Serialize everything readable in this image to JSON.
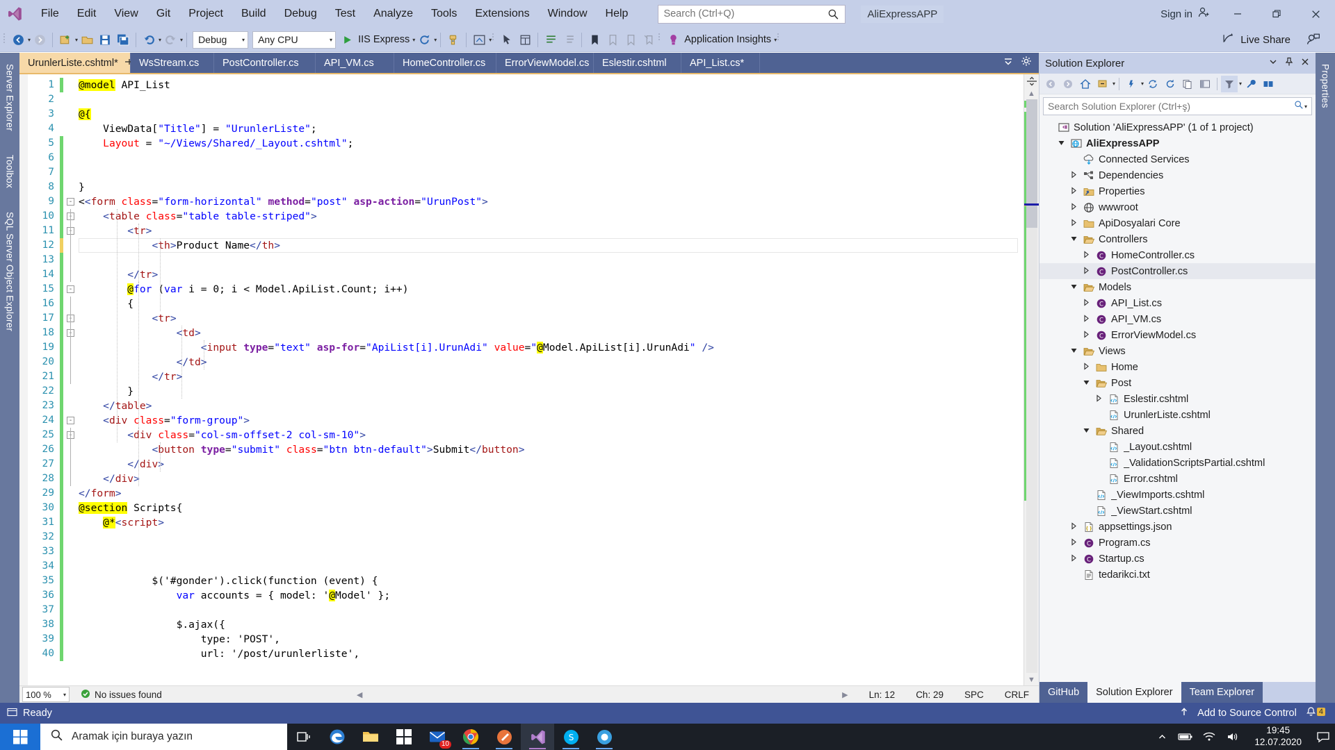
{
  "titlebar": {
    "logo_icon": "visual-studio-logo",
    "menus": [
      "File",
      "Edit",
      "View",
      "Git",
      "Project",
      "Build",
      "Debug",
      "Test",
      "Analyze",
      "Tools",
      "Extensions",
      "Window",
      "Help"
    ],
    "search_placeholder": "Search (Ctrl+Q)",
    "search_icon": "magnifier-icon",
    "project_name": "AliExpressAPP",
    "sign_in": "Sign in",
    "sign_in_icon": "account-add-icon",
    "minimize_icon": "minimize-icon",
    "restore_icon": "restore-icon",
    "close_icon": "close-icon"
  },
  "toolbar": {
    "back_icon": "navigate-back-icon",
    "forward_icon": "navigate-forward-icon",
    "new_project_icon": "new-project-icon",
    "open_icon": "open-file-icon",
    "save_icon": "save-icon",
    "save_all_icon": "save-all-icon",
    "undo_icon": "undo-icon",
    "redo_icon": "redo-icon",
    "config_value": "Debug",
    "platform_value": "Any CPU",
    "run_icon": "play-icon",
    "run_label": "IIS Express",
    "hot_reload_icon": "hot-reload-icon",
    "bookmark_icon": "bookmark-icon",
    "app_insights_label": "Application Insights",
    "live_share_label": "Live Share",
    "live_share_icon": "live-share-icon",
    "feedback_icon": "feedback-icon"
  },
  "left_dock": [
    "Server Explorer",
    "Toolbox",
    "SQL Server Object Explorer"
  ],
  "right_dock": [
    "Properties"
  ],
  "editor": {
    "tabs": [
      {
        "label": "UrunlerListe.cshtml*",
        "active": true,
        "pin_icon": "pin-icon",
        "close_icon": "close-icon"
      },
      {
        "label": "WsStream.cs",
        "active": false
      },
      {
        "label": "PostController.cs",
        "active": false
      },
      {
        "label": "API_VM.cs",
        "active": false
      },
      {
        "label": "HomeController.cs",
        "active": false
      },
      {
        "label": "ErrorViewModel.cs",
        "active": false
      },
      {
        "label": "Eslestir.cshtml",
        "active": false
      },
      {
        "label": "API_List.cs*",
        "active": false
      }
    ],
    "tab_overflow_icon": "chevron-down-icon",
    "tab_settings_icon": "gear-icon",
    "line_numbers": [
      1,
      2,
      3,
      4,
      5,
      6,
      7,
      8,
      9,
      10,
      11,
      12,
      13,
      14,
      15,
      16,
      17,
      18,
      19,
      20,
      21,
      22,
      23,
      24,
      25,
      26,
      27,
      28,
      29,
      30,
      31,
      32,
      33,
      34,
      35,
      36,
      37,
      38,
      39,
      40
    ],
    "code_lines": [
      "@model API_List",
      "",
      "@{",
      "    ViewData[\"Title\"] = \"UrunlerListe\";",
      "    Layout = \"~/Views/Shared/_Layout.cshtml\";",
      "",
      "",
      "}",
      "<<form class=\"form-horizontal\" method=\"post\" asp-action=\"UrunPost\">",
      "    <table class=\"table table-striped\">",
      "        <tr>",
      "            <th>Product Name</th>",
      "",
      "        </tr>",
      "        @for (var i = 0; i < Model.ApiList.Count; i++)",
      "        {",
      "            <tr>",
      "                <td>",
      "                    <input type=\"text\" asp-for=\"ApiList[i].UrunAdi\" value=\"@Model.ApiList[i].UrunAdi\" />",
      "                </td>",
      "            </tr>",
      "        }",
      "    </table>",
      "    <div class=\"form-group\">",
      "        <div class=\"col-sm-offset-2 col-sm-10\">",
      "            <button type=\"submit\" class=\"btn btn-default\">Submit</button>",
      "        </div>",
      "    </div>",
      "</form>",
      "@section Scripts{",
      "    @*<script>",
      "",
      "",
      "",
      "            $('#gonder').click(function (event) {",
      "                var accounts = { model: '@Model' };",
      "",
      "                $.ajax({",
      "                    type: 'POST',",
      "                    url: '/post/urunlerliste',"
    ]
  },
  "editor_status": {
    "zoom": "100 %",
    "issues_icon": "check-circle-icon",
    "issues_text": "No issues found",
    "line": "Ln: 12",
    "col": "Ch: 29",
    "spaces": "SPC",
    "eol": "CRLF"
  },
  "solution_explorer": {
    "title": "Solution Explorer",
    "pin_icon": "pin-icon",
    "close_icon": "close-icon",
    "dropdown_icon": "chevron-down-icon",
    "search_placeholder": "Search Solution Explorer (Ctrl+ş)",
    "search_icon": "magnifier-icon",
    "toolbar_icons": [
      "back-icon",
      "forward-icon",
      "home-icon",
      "collapse-all-icon",
      "properties-icon",
      "sync-icon",
      "refresh-icon",
      "show-all-files-icon",
      "filter-icon",
      "preview-icon",
      "wrench-icon",
      "split-icon"
    ],
    "tree": [
      {
        "depth": 0,
        "expander": "none",
        "icon": "solution-icon",
        "label": "Solution 'AliExpressAPP' (1 of 1 project)",
        "bold": false
      },
      {
        "depth": 1,
        "expander": "expanded",
        "icon": "web-project-icon",
        "label": "AliExpressAPP",
        "bold": true
      },
      {
        "depth": 2,
        "expander": "none",
        "icon": "connected-services-icon",
        "label": "Connected Services",
        "bold": false
      },
      {
        "depth": 2,
        "expander": "collapsed",
        "icon": "dependencies-icon",
        "label": "Dependencies",
        "bold": false
      },
      {
        "depth": 2,
        "expander": "collapsed",
        "icon": "properties-folder-icon",
        "label": "Properties",
        "bold": false
      },
      {
        "depth": 2,
        "expander": "collapsed",
        "icon": "wwwroot-icon",
        "label": "wwwroot",
        "bold": false
      },
      {
        "depth": 2,
        "expander": "collapsed",
        "icon": "folder-icon",
        "label": "ApiDosyalari Core",
        "bold": false
      },
      {
        "depth": 2,
        "expander": "expanded",
        "icon": "folder-open-icon",
        "label": "Controllers",
        "bold": false
      },
      {
        "depth": 3,
        "expander": "collapsed",
        "icon": "csharp-file-icon",
        "label": "HomeController.cs",
        "bold": false
      },
      {
        "depth": 3,
        "expander": "collapsed",
        "icon": "csharp-file-icon",
        "label": "PostController.cs",
        "bold": false,
        "selected": true
      },
      {
        "depth": 2,
        "expander": "expanded",
        "icon": "folder-open-icon",
        "label": "Models",
        "bold": false
      },
      {
        "depth": 3,
        "expander": "collapsed",
        "icon": "csharp-file-icon",
        "label": "API_List.cs",
        "bold": false
      },
      {
        "depth": 3,
        "expander": "collapsed",
        "icon": "csharp-file-icon",
        "label": "API_VM.cs",
        "bold": false
      },
      {
        "depth": 3,
        "expander": "collapsed",
        "icon": "csharp-file-icon",
        "label": "ErrorViewModel.cs",
        "bold": false
      },
      {
        "depth": 2,
        "expander": "expanded",
        "icon": "folder-open-icon",
        "label": "Views",
        "bold": false
      },
      {
        "depth": 3,
        "expander": "collapsed",
        "icon": "folder-icon",
        "label": "Home",
        "bold": false
      },
      {
        "depth": 3,
        "expander": "expanded",
        "icon": "folder-open-icon",
        "label": "Post",
        "bold": false
      },
      {
        "depth": 4,
        "expander": "collapsed",
        "icon": "cshtml-file-icon",
        "label": "Eslestir.cshtml",
        "bold": false
      },
      {
        "depth": 4,
        "expander": "none",
        "icon": "cshtml-file-icon",
        "label": "UrunlerListe.cshtml",
        "bold": false
      },
      {
        "depth": 3,
        "expander": "expanded",
        "icon": "folder-open-icon",
        "label": "Shared",
        "bold": false
      },
      {
        "depth": 4,
        "expander": "none",
        "icon": "cshtml-file-icon",
        "label": "_Layout.cshtml",
        "bold": false
      },
      {
        "depth": 4,
        "expander": "none",
        "icon": "cshtml-file-icon",
        "label": "_ValidationScriptsPartial.cshtml",
        "bold": false
      },
      {
        "depth": 4,
        "expander": "none",
        "icon": "cshtml-file-icon",
        "label": "Error.cshtml",
        "bold": false
      },
      {
        "depth": 3,
        "expander": "none",
        "icon": "cshtml-file-icon",
        "label": "_ViewImports.cshtml",
        "bold": false
      },
      {
        "depth": 3,
        "expander": "none",
        "icon": "cshtml-file-icon",
        "label": "_ViewStart.cshtml",
        "bold": false
      },
      {
        "depth": 2,
        "expander": "collapsed",
        "icon": "json-file-icon",
        "label": "appsettings.json",
        "bold": false
      },
      {
        "depth": 2,
        "expander": "collapsed",
        "icon": "csharp-file-icon",
        "label": "Program.cs",
        "bold": false
      },
      {
        "depth": 2,
        "expander": "collapsed",
        "icon": "csharp-file-icon",
        "label": "Startup.cs",
        "bold": false
      },
      {
        "depth": 2,
        "expander": "none",
        "icon": "text-file-icon",
        "label": "tedarikci.txt",
        "bold": false
      }
    ],
    "bottom_tabs": [
      {
        "label": "GitHub",
        "active": false
      },
      {
        "label": "Solution Explorer",
        "active": true
      },
      {
        "label": "Team Explorer",
        "active": false
      }
    ]
  },
  "vs_status": {
    "ready_icon": "ready-icon",
    "ready_text": "Ready",
    "source_control_icon": "up-arrow-icon",
    "source_control_text": "Add to Source Control",
    "notifications_icon": "bell-icon",
    "notification_count": "4"
  },
  "taskbar": {
    "start_icon": "windows-start-icon",
    "search_icon": "magnifier-icon",
    "search_placeholder": "Aramak için buraya yazın",
    "task_view_icon": "task-view-icon",
    "apps": [
      {
        "icon": "edge-icon",
        "running": false
      },
      {
        "icon": "file-explorer-icon",
        "running": false
      },
      {
        "icon": "microsoft-store-icon",
        "running": false
      },
      {
        "icon": "mail-icon",
        "running": false,
        "badge": "10"
      },
      {
        "icon": "chrome-icon",
        "running": true
      },
      {
        "icon": "postman-icon",
        "running": true
      },
      {
        "icon": "visual-studio-icon",
        "running": true,
        "focused": true
      },
      {
        "icon": "skype-icon",
        "running": true
      },
      {
        "icon": "app-icon",
        "running": true
      }
    ],
    "tray_icons": [
      "show-hidden-icons-icon",
      "battery-icon",
      "wifi-icon",
      "volume-icon"
    ],
    "time": "19:45",
    "date": "12.07.2020",
    "action-center_icon": "action-center-icon"
  },
  "colors": {
    "titlebar_bg": "#c5cfe8",
    "tab_inactive_bg": "#4f6293",
    "tab_active_bg": "#f7d9a8",
    "status_bg": "#3f5495",
    "dock_bg": "#68789e",
    "accent_orange": "#e8b96a",
    "changebar_green": "#6fd66f",
    "changebar_yellow": "#f0d060",
    "taskbar_bg": "#1b1f26"
  }
}
